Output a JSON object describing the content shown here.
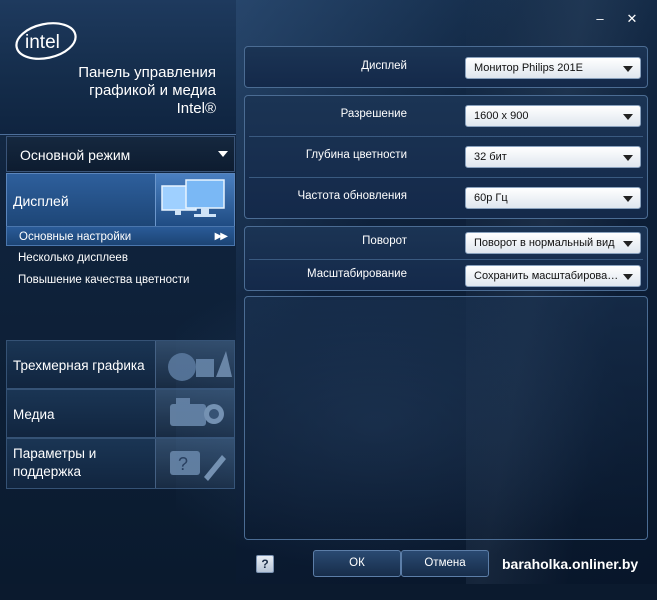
{
  "window": {
    "minimize_label": "–",
    "close_label": "✕"
  },
  "header": {
    "logo_text": "intel",
    "title_line1": "Панель управления",
    "title_line2": "графикой и медиа",
    "title_line3": "Intel®"
  },
  "mode": {
    "label": "Основной режим"
  },
  "nav": {
    "display": {
      "label": "Дисплей",
      "icon": "monitors-icon",
      "sub_items": [
        {
          "label": "Основные настройки",
          "active": true
        },
        {
          "label": "Несколько дисплеев",
          "active": false
        },
        {
          "label": "Повышение качества цветности",
          "active": false
        }
      ]
    },
    "items": [
      {
        "label": "Трехмерная графика",
        "icon": "3d-shapes-icon"
      },
      {
        "label": "Медиа",
        "icon": "camera-icon"
      },
      {
        "label_line1": "Параметры и",
        "label_line2": "поддержка",
        "icon": "tools-icon"
      }
    ]
  },
  "settings": {
    "display": {
      "label": "Дисплей",
      "value": "Монитор Philips 201E"
    },
    "resolution": {
      "label": "Разрешение",
      "value": "1600 x 900"
    },
    "color_depth": {
      "label": "Глубина цветности",
      "value": "32 бит"
    },
    "refresh_rate": {
      "label": "Частота обновления",
      "value": "60p Гц"
    },
    "rotation": {
      "label": "Поворот",
      "value": "Поворот в нормальный вид"
    },
    "scaling": {
      "label": "Масштабирование",
      "value": "Сохранить масштабирован..."
    }
  },
  "footer": {
    "help_label": "?",
    "ok_label": "ОК",
    "cancel_label": "Отмена",
    "watermark": "baraholka.onliner.by"
  },
  "colors": {
    "accent": "#2e5f9c",
    "background": "#0d1f38"
  }
}
